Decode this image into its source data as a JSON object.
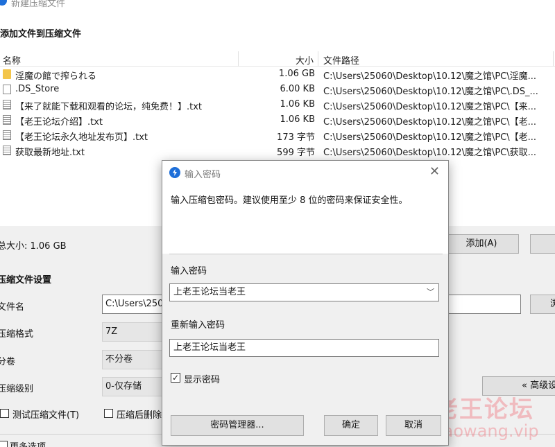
{
  "window": {
    "title": "新建压缩文件"
  },
  "add_section": {
    "heading": "添加文件到压缩文件"
  },
  "file_table": {
    "columns": {
      "name": "名称",
      "size": "大小",
      "path": "文件路径"
    },
    "rows": [
      {
        "icon": "folder-icon",
        "name": "淫魔の館で搾られる",
        "size": "1.06 GB",
        "path": "C:\\Users\\25060\\Desktop\\10.12\\魔之馆\\PC\\淫魔..."
      },
      {
        "icon": "file-icon",
        "name": ".DS_Store",
        "size": "6.00 KB",
        "path": "C:\\Users\\25060\\Desktop\\10.12\\魔之馆\\PC\\.DS_..."
      },
      {
        "icon": "text-file-icon",
        "name": "【来了就能下载和观看的论坛，纯免费！】.txt",
        "size": "1.06 KB",
        "path": "C:\\Users\\25060\\Desktop\\10.12\\魔之馆\\PC\\【来..."
      },
      {
        "icon": "text-file-icon",
        "name": "【老王论坛介绍】.txt",
        "size": "1.06 KB",
        "path": "C:\\Users\\25060\\Desktop\\10.12\\魔之馆\\PC\\【老..."
      },
      {
        "icon": "text-file-icon",
        "name": "【老王论坛永久地址发布页】.txt",
        "size": "173 字节",
        "path": "C:\\Users\\25060\\Desktop\\10.12\\魔之馆\\PC\\【老..."
      },
      {
        "icon": "text-file-icon",
        "name": "获取最新地址.txt",
        "size": "599 字节",
        "path": "C:\\Users\\25060\\Desktop\\10.12\\魔之馆\\PC\\获取..."
      }
    ]
  },
  "total_size": "总大小: 1.06 GB",
  "add_button": "添加(A)",
  "settings": {
    "heading": "压缩文件设置",
    "filename_label": "文件名",
    "filename_value": "C:\\Users\\250",
    "format_label": "压缩格式",
    "format_value": "7Z",
    "split_label": "分卷",
    "split_value": "不分卷",
    "level_label": "压缩级别",
    "level_value": "0-仅存储",
    "test_label": "测试压缩文件(T)",
    "delete_label": "压缩后删除",
    "advanced_button": "« 高级设",
    "browse_button": "浏",
    "more_options": "更多选项"
  },
  "dialog": {
    "title": "输入密码",
    "description": "输入压缩包密码。建议使用至少 8 位的密码来保证安全性。",
    "password_label": "输入密码",
    "password_value": "上老王论坛当老王",
    "reenter_label": "重新输入密码",
    "reenter_value": "上老王论坛当老王",
    "show_password_label": "显示密码",
    "show_password_checked": true,
    "manager_button": "密码管理器...",
    "ok_button": "确定",
    "cancel_button": "取消"
  },
  "watermark": {
    "text": "老王论坛",
    "url": "laowang.vip"
  }
}
